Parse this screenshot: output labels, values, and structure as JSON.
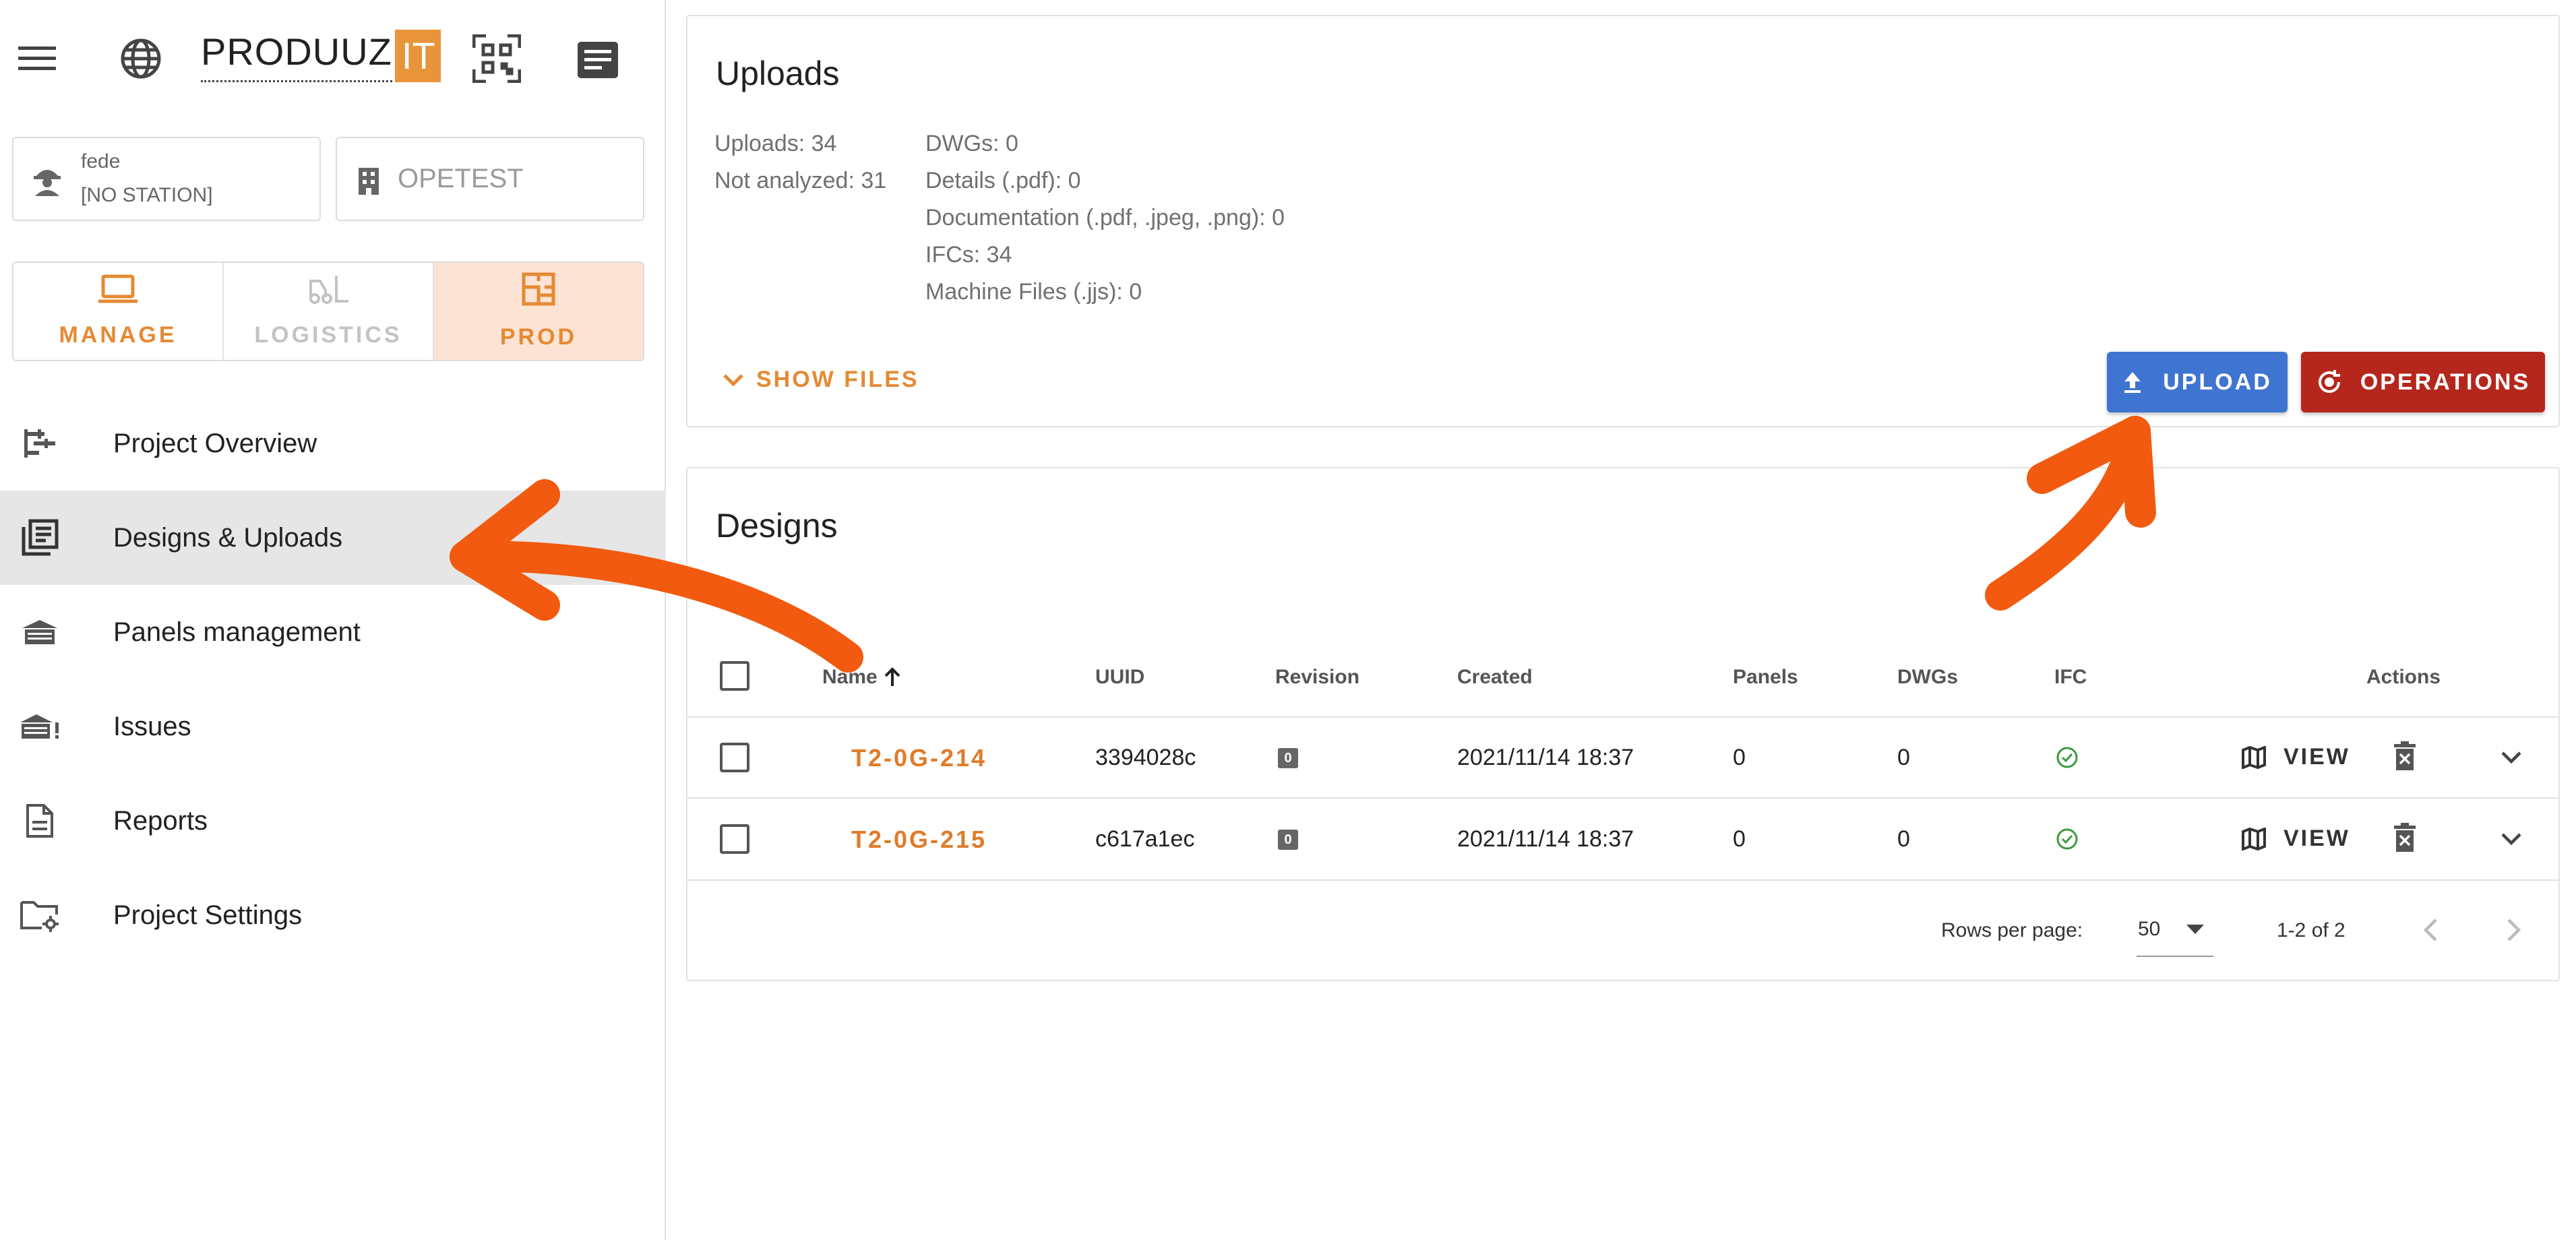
{
  "app": {
    "brand_main": "PRODUUZ",
    "brand_accent": "IT",
    "accent_color": "#e58a33"
  },
  "user": {
    "name": "fede",
    "station": "[NO STATION]"
  },
  "project_code": "OPETEST",
  "modes": [
    {
      "label": "MANAGE",
      "icon": "laptop-icon"
    },
    {
      "label": "LOGISTICS",
      "icon": "forklift-icon"
    },
    {
      "label": "PROD",
      "icon": "layout-icon"
    }
  ],
  "nav": [
    {
      "label": "Project Overview",
      "icon": "overview-icon"
    },
    {
      "label": "Designs & Uploads",
      "icon": "designs-icon"
    },
    {
      "label": "Panels management",
      "icon": "panels-icon"
    },
    {
      "label": "Issues",
      "icon": "issues-icon"
    },
    {
      "label": "Reports",
      "icon": "report-icon"
    },
    {
      "label": "Project Settings",
      "icon": "folder-settings-icon"
    }
  ],
  "uploads": {
    "title": "Uploads",
    "uploads_count": "Uploads: 34",
    "not_analyzed": "Not analyzed: 31",
    "dwgs": "DWGs: 0",
    "details": "Details (.pdf): 0",
    "documentation": "Documentation (.pdf, .jpeg, .png): 0",
    "ifcs": "IFCs: 34",
    "machine_files": "Machine Files (.jjs): 0",
    "show_files": "SHOW FILES",
    "upload_btn": "UPLOAD",
    "operations_btn": "OPERATIONS"
  },
  "designs": {
    "title": "Designs",
    "columns": {
      "name": "Name",
      "uuid": "UUID",
      "revision": "Revision",
      "created": "Created",
      "panels": "Panels",
      "dwgs": "DWGs",
      "ifc": "IFC",
      "actions": "Actions"
    },
    "rows": [
      {
        "name": "T2-0G-214",
        "uuid": "3394028c",
        "revision": "0",
        "created": "2021/11/14 18:37",
        "panels": "0",
        "dwgs": "0",
        "view": "VIEW"
      },
      {
        "name": "T2-0G-215",
        "uuid": "c617a1ec",
        "revision": "0",
        "created": "2021/11/14 18:37",
        "panels": "0",
        "dwgs": "0",
        "view": "VIEW"
      }
    ],
    "rows_per_page_label": "Rows per page:",
    "rows_per_page": "50",
    "range": "1-2 of 2"
  }
}
